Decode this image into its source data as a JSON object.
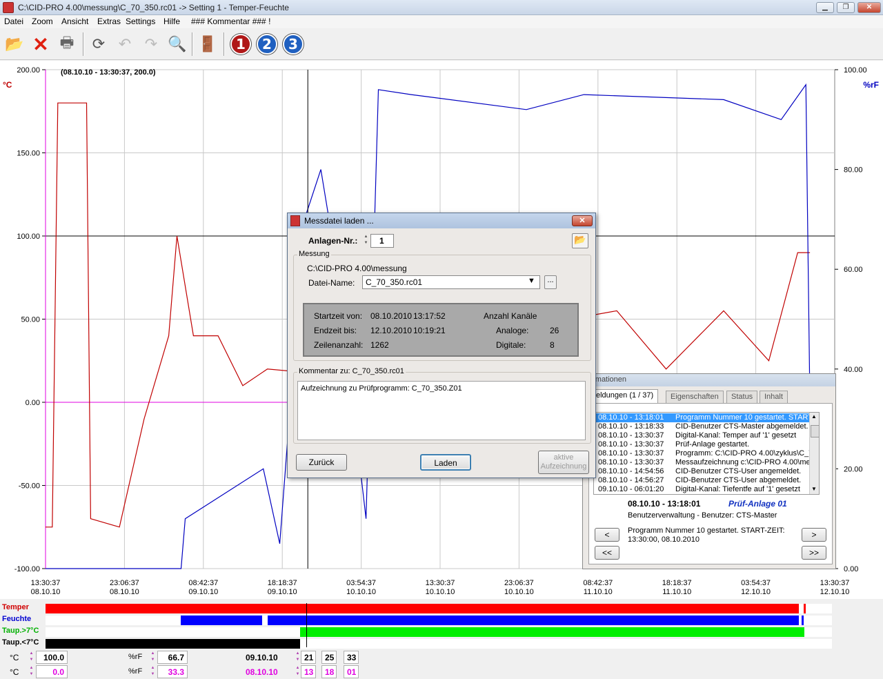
{
  "window": {
    "title": "C:\\CID-PRO 4.00\\messung\\C_70_350.rc01    ->    Setting 1 - Temper-Feuchte"
  },
  "menu": [
    "Datei",
    "Zoom",
    "Ansicht",
    "Extras",
    "Settings",
    "Hilfe",
    "### Kommentar ### !"
  ],
  "toolbar": {
    "icons": [
      "open-folder-icon",
      "delete-x-icon",
      "printer-icon",
      "refresh-icon",
      "undo-icon",
      "redo-icon",
      "search-magnifier-icon",
      "exit-door-icon"
    ],
    "numbers": [
      {
        "label": "1",
        "color": "#b01818"
      },
      {
        "label": "2",
        "color": "#2060c0"
      },
      {
        "label": "3",
        "color": "#2060c0"
      }
    ]
  },
  "chart": {
    "cursor_readout": "(08.10.10 - 13:30:37, 200.0)",
    "left_unit": "°C",
    "right_unit": "%rF",
    "left_ticks": [
      "200.00",
      "150.00",
      "100.00",
      "50.00",
      "0.00",
      "-50.00",
      "-100.00"
    ],
    "right_ticks": [
      "100.00",
      "80.00",
      "60.00",
      "40.00",
      "20.00",
      "0.00"
    ],
    "x_ticks": [
      {
        "time": "13:30:37",
        "date": "08.10.10"
      },
      {
        "time": "23:06:37",
        "date": "08.10.10"
      },
      {
        "time": "08:42:37",
        "date": "09.10.10"
      },
      {
        "time": "18:18:37",
        "date": "09.10.10"
      },
      {
        "time": "03:54:37",
        "date": "10.10.10"
      },
      {
        "time": "13:30:37",
        "date": "10.10.10"
      },
      {
        "time": "23:06:37",
        "date": "10.10.10"
      },
      {
        "time": "08:42:37",
        "date": "11.10.10"
      },
      {
        "time": "18:18:37",
        "date": "11.10.10"
      },
      {
        "time": "03:54:37",
        "date": "12.10.10"
      },
      {
        "time": "13:30:37",
        "date": "12.10.10"
      }
    ],
    "colors": {
      "temperature": "#c00000",
      "humidity": "#0000c0",
      "zero_line": "#e000e0",
      "cursor": "#000000"
    }
  },
  "chart_data": {
    "type": "line",
    "title": "",
    "xlabel": "",
    "ylabel": "°C",
    "y2label": "%rF",
    "ylim": [
      -100,
      200
    ],
    "y2lim": [
      0,
      100
    ],
    "x_range": [
      "08.10.10 13:30:37",
      "12.10.10 13:30:37"
    ],
    "series": [
      {
        "name": "Temper",
        "axis": "left",
        "approx_points": [
          [
            "08.10.10 13:30",
            -75
          ],
          [
            "08.10.10 14:20",
            -75
          ],
          [
            "08.10.10 15:00",
            180
          ],
          [
            "08.10.10 18:30",
            180
          ],
          [
            "08.10.10 19:00",
            -70
          ],
          [
            "08.10.10 22:30",
            -75
          ],
          [
            "09.10.10 01:30",
            -10
          ],
          [
            "09.10.10 04:30",
            40
          ],
          [
            "09.10.10 05:30",
            100
          ],
          [
            "09.10.10 07:30",
            40
          ],
          [
            "09.10.10 10:30",
            40
          ],
          [
            "09.10.10 13:30",
            10
          ],
          [
            "09.10.10 16:30",
            20
          ],
          [
            "09.10.10 21:00",
            18
          ],
          [
            "09.10.10 22:00",
            95
          ],
          [
            "10.10.10 01:00",
            25
          ],
          [
            "11.10.10 11:00",
            55
          ],
          [
            "11.10.10 17:00",
            20
          ],
          [
            "12.10.10 00:00",
            55
          ],
          [
            "12.10.10 05:30",
            25
          ],
          [
            "12.10.10 09:00",
            90
          ],
          [
            "12.10.10 10:30",
            90
          ]
        ]
      },
      {
        "name": "Feuchte",
        "axis": "right",
        "approx_points": [
          [
            "08.10.10 13:30",
            0
          ],
          [
            "09.10.10 06:00",
            0
          ],
          [
            "09.10.10 06:30",
            10
          ],
          [
            "09.10.10 16:00",
            20
          ],
          [
            "09.10.10 18:00",
            5
          ],
          [
            "09.10.10 21:00",
            70
          ],
          [
            "09.10.10 23:00",
            80
          ],
          [
            "10.10.10 01:00",
            60
          ],
          [
            "10.10.10 04:30",
            10
          ],
          [
            "10.10.10 06:00",
            96
          ],
          [
            "10.10.10 10:00",
            95
          ],
          [
            "11.10.10 00:00",
            92
          ],
          [
            "11.10.10 07:00",
            95
          ],
          [
            "12.10.10 00:00",
            94
          ],
          [
            "12.10.10 07:00",
            90
          ],
          [
            "12.10.10 10:00",
            97
          ],
          [
            "12.10.10 10:45",
            0
          ]
        ]
      }
    ]
  },
  "legend": [
    {
      "label": "Temper",
      "color": "#ff0000"
    },
    {
      "label": "Feuchte",
      "color": "#0000ff"
    },
    {
      "label": "Taup.>7°C",
      "color": "#00dd00"
    },
    {
      "label": "Taup.<7°C",
      "color": "#000000"
    }
  ],
  "readout": {
    "row1": {
      "unit1": "°C",
      "val1": "100.0",
      "unit2": "%rF",
      "val2": "66.7",
      "date": "09.10.10",
      "h": "21",
      "m": "25",
      "s": "33"
    },
    "row2": {
      "unit1": "°C",
      "val1": "0.0",
      "unit2": "%rF",
      "val2": "33.3",
      "date": "08.10.10",
      "h": "13",
      "m": "18",
      "s": "01"
    }
  },
  "dialog": {
    "title": "Messdatei laden ...",
    "anlagen_label": "Anlagen-Nr.:",
    "anlagen_value": "1",
    "group_messung": "Messung",
    "path": "C:\\CID-PRO 4.00\\messung",
    "datei_label": "Datei-Name:",
    "datei_value": "C_70_350.rc01",
    "browse": "...",
    "start_label": "Startzeit von:",
    "start_date": "08.10.2010",
    "start_time": "13:17:52",
    "end_label": "Endzeit bis:",
    "end_date": "12.10.2010",
    "end_time": "10:19:21",
    "rows_label": "Zeilenanzahl:",
    "rows_value": "1262",
    "channels_label": "Anzahl Kanäle",
    "analog_label": "Analoge:",
    "analog_value": "26",
    "digital_label": "Digitale:",
    "digital_value": "8",
    "comment_group": "Kommentar zu: C_70_350.rc01",
    "comment_text": "Aufzeichnung zu Prüfprogramm: C_70_350.Z01",
    "btn_back": "Zurück",
    "btn_load": "Laden",
    "btn_active_1": "aktive",
    "btn_active_2": "Aufzeichnung"
  },
  "info_panel": {
    "title": "ormationen",
    "tabs": [
      "eldungen  (1 / 37)",
      "Eigenschaften",
      "Status",
      "Inhalt"
    ],
    "messages": [
      {
        "date": "08.10.10 - 13:18:01",
        "text": "Programm Nummer 10 gestartet. START-Z"
      },
      {
        "date": "08.10.10 - 13:18:33",
        "text": "CID-Benutzer CTS-Master abgemeldet."
      },
      {
        "date": "08.10.10 - 13:30:37",
        "text": "Digital-Kanal: Temper auf '1' gesetzt"
      },
      {
        "date": "08.10.10 - 13:30:37",
        "text": "Prüf-Anlage gestartet."
      },
      {
        "date": "08.10.10 - 13:30:37",
        "text": "Programm: C:\\CID-PRO 4.00\\zyklus\\C_70"
      },
      {
        "date": "08.10.10 - 13:30:37",
        "text": "Messaufzeichnung c:\\CID-PRO 4.00\\mes"
      },
      {
        "date": "08.10.10 - 14:54:56",
        "text": "CID-Benutzer CTS-User angemeldet."
      },
      {
        "date": "08.10.10 - 14:56:27",
        "text": "CID-Benutzer CTS-User abgemeldet."
      },
      {
        "date": "09.10.10 - 06:01:20",
        "text": "Digital-Kanal: Tiefentfe auf '1' gesetzt"
      }
    ],
    "detail_time": "08.10.10 - 13:18:01",
    "detail_unit": "Prüf-Anlage 01",
    "detail_user": "Benutzerverwaltung - Benutzer: CTS-Master",
    "detail_msg1": "Programm Nummer 10 gestartet. START-ZEIT:",
    "detail_msg2": "13:30:00, 08.10.2010",
    "nav_prev": "<",
    "nav_next": ">",
    "nav_first": "<<",
    "nav_last": ">>"
  }
}
